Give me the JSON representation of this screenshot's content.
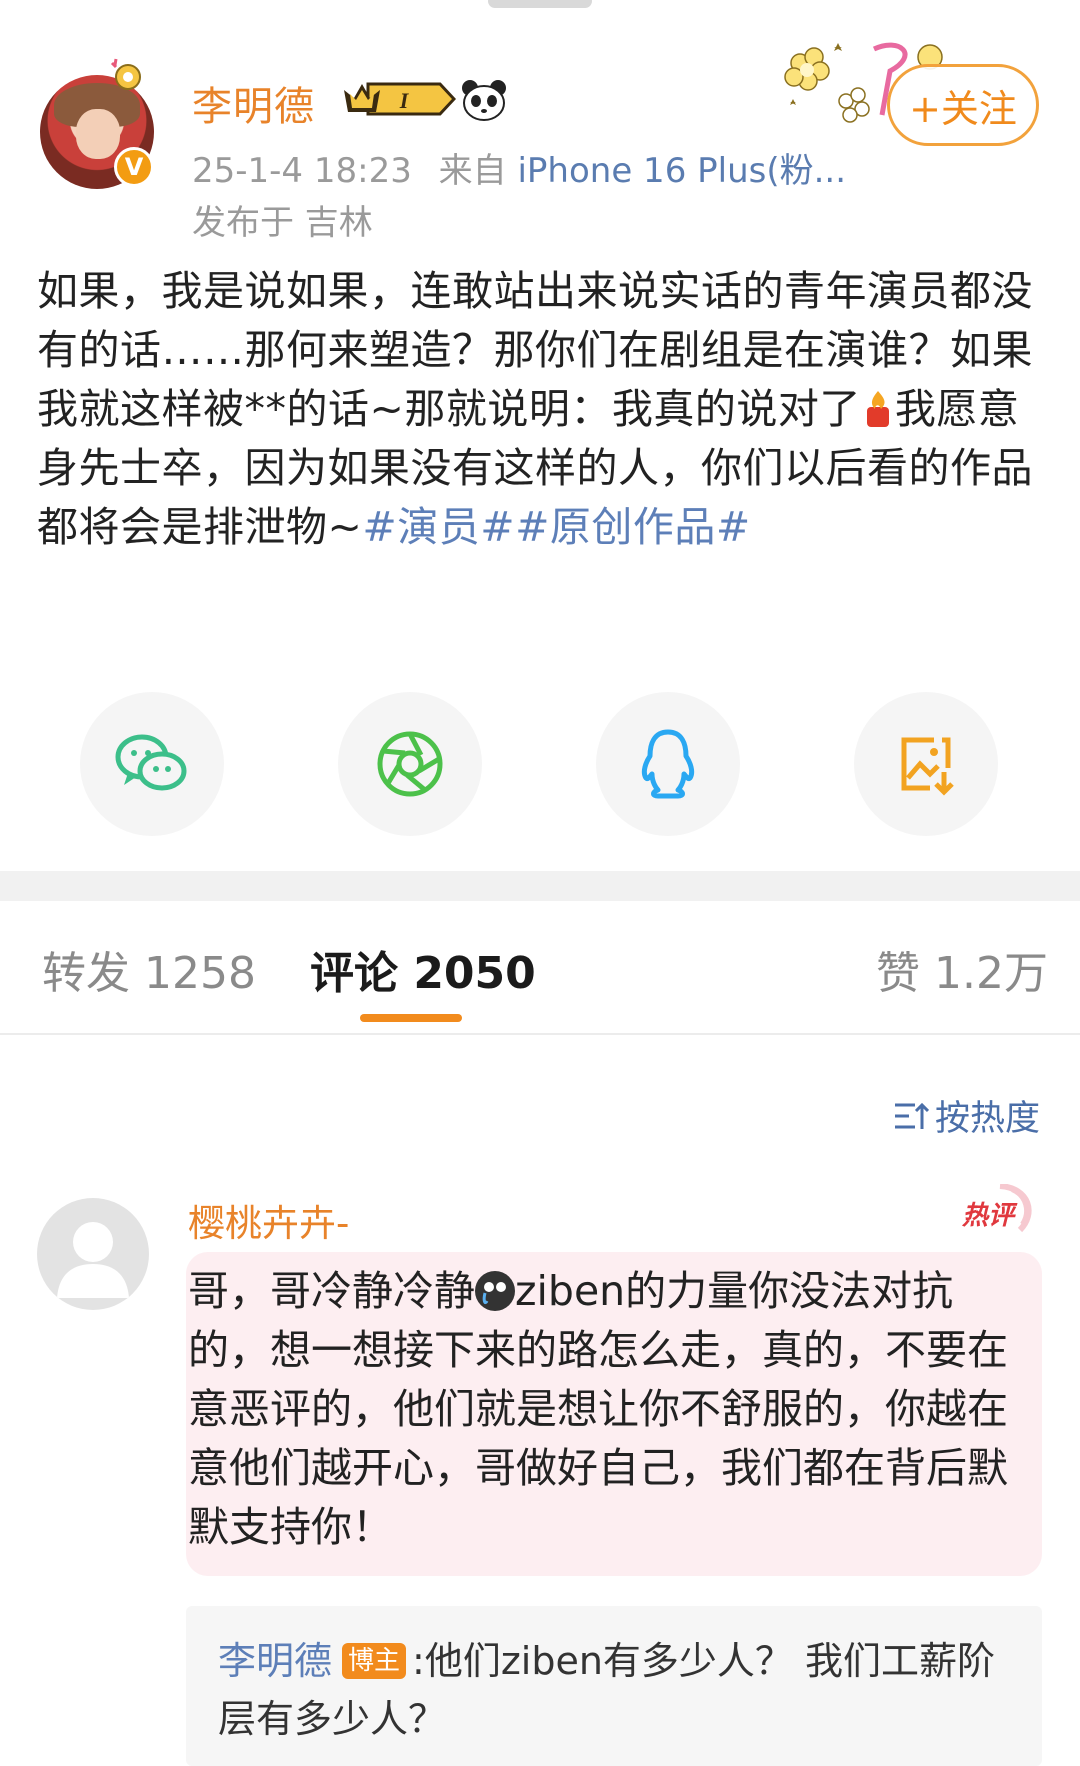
{
  "post": {
    "author": "李明德",
    "timestamp": "25-1-4 18:23",
    "source_prefix": "来自",
    "device": "iPhone 16 Plus(粉...",
    "location": "发布于 吉林",
    "follow_label": "+关注",
    "level_badge": "I",
    "text": {
      "line_a": "如果，我是说如果，连敢站出来说实话的青年演员都没有的话……那何来塑造？那你们在剧组是在演谁？如果我就这样被**的话~那就说明：我真的说对了",
      "line_b": "我愿意身先士卒，因为如果没有这样的人，你们以后看的作品都将会是排泄物~",
      "topic_1": "#演员#",
      "topic_2": "#原创作品#"
    }
  },
  "share_buttons": [
    {
      "icon": "wechat-icon"
    },
    {
      "icon": "moments-icon"
    },
    {
      "icon": "qq-icon"
    },
    {
      "icon": "save-image-icon"
    }
  ],
  "tabs": {
    "repost": "转发 1258",
    "comments": "评论 2050",
    "likes": "赞 1.2万"
  },
  "sort_label": "按热度",
  "comment": {
    "author": "樱桃卉卉-",
    "hot_label": "热评",
    "text_a": "哥，哥冷静冷静",
    "text_b": "ziben的力量你没法对抗的，想一想接下来的路怎么走，真的，不要在意恶评的，他们就是想让你不舒服的，你越在意他们越开心，哥做好自己，我们都在背后默默支持你！",
    "reply": {
      "author": "李明德",
      "tag": "博主",
      "text": ":他们ziben有多少人？ 我们工薪阶层有多少人？"
    }
  },
  "colors": {
    "accent_orange": "#f28b1d",
    "link_blue": "#5d7fb8",
    "username_orange": "#e8832a",
    "comment_bg": "#fdeef1"
  }
}
